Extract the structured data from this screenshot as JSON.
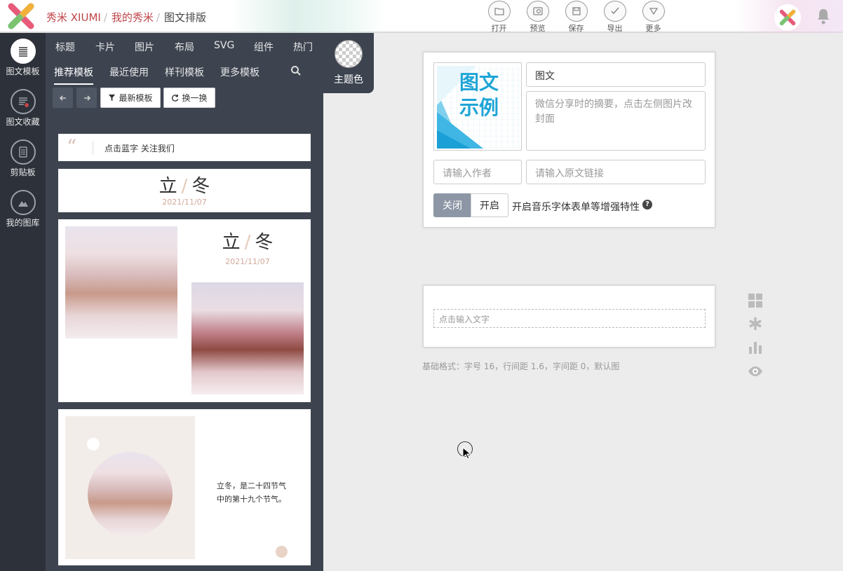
{
  "breadcrumb": {
    "site": "秀米 XIUMI",
    "mine": "我的秀米",
    "current": "图文排版"
  },
  "toolbar": [
    {
      "label": "打开",
      "icon": "folder-icon"
    },
    {
      "label": "预览",
      "icon": "preview-icon"
    },
    {
      "label": "保存",
      "icon": "save-icon"
    },
    {
      "label": "导出",
      "icon": "check-icon"
    },
    {
      "label": "更多",
      "icon": "triangle-down-icon"
    }
  ],
  "rail": [
    {
      "label": "图文模板",
      "icon": "template-icon"
    },
    {
      "label": "图文收藏",
      "icon": "favorites-icon"
    },
    {
      "label": "剪贴板",
      "icon": "clipboard-icon"
    },
    {
      "label": "我的图库",
      "icon": "gallery-icon"
    }
  ],
  "panel": {
    "tabs": [
      "标题",
      "卡片",
      "图片",
      "布局",
      "SVG",
      "组件",
      "热门"
    ],
    "subtabs": [
      "推荐模板",
      "最近使用",
      "样刊模板",
      "更多模板"
    ],
    "filter_btn": "最新模板",
    "swap_btn": "换一换",
    "quote_text": "点击蓝字 关注我们",
    "title_char1": "立",
    "title_slash": "/",
    "title_char2": "冬",
    "date": "2021/11/07",
    "date2": "2021/11/07",
    "body_text": "立冬，是二十四节气中的第十九个节气。"
  },
  "theme_label": "主题色",
  "editor": {
    "cover_text_1": "图文",
    "cover_text_2": "示例",
    "title_value": "图文",
    "summary_placeholder": "微信分享时的摘要，点击左侧图片改封面",
    "author_placeholder": "请输入作者",
    "link_placeholder": "请输入原文链接",
    "toggle_off": "关闭",
    "toggle_on": "开启",
    "toggle_desc": "开启音乐字体表单等增强特性",
    "text_placeholder": "点击输入文字",
    "format_info": "基础格式：字号 16，行间距 1.6，字间距 0，默认图"
  },
  "colors": {
    "accent": "#c0464a",
    "panel": "#3d4450",
    "rail": "#2c313a",
    "toggle_active": "#8d96a5",
    "cover_blue": "#1ea5d6"
  }
}
